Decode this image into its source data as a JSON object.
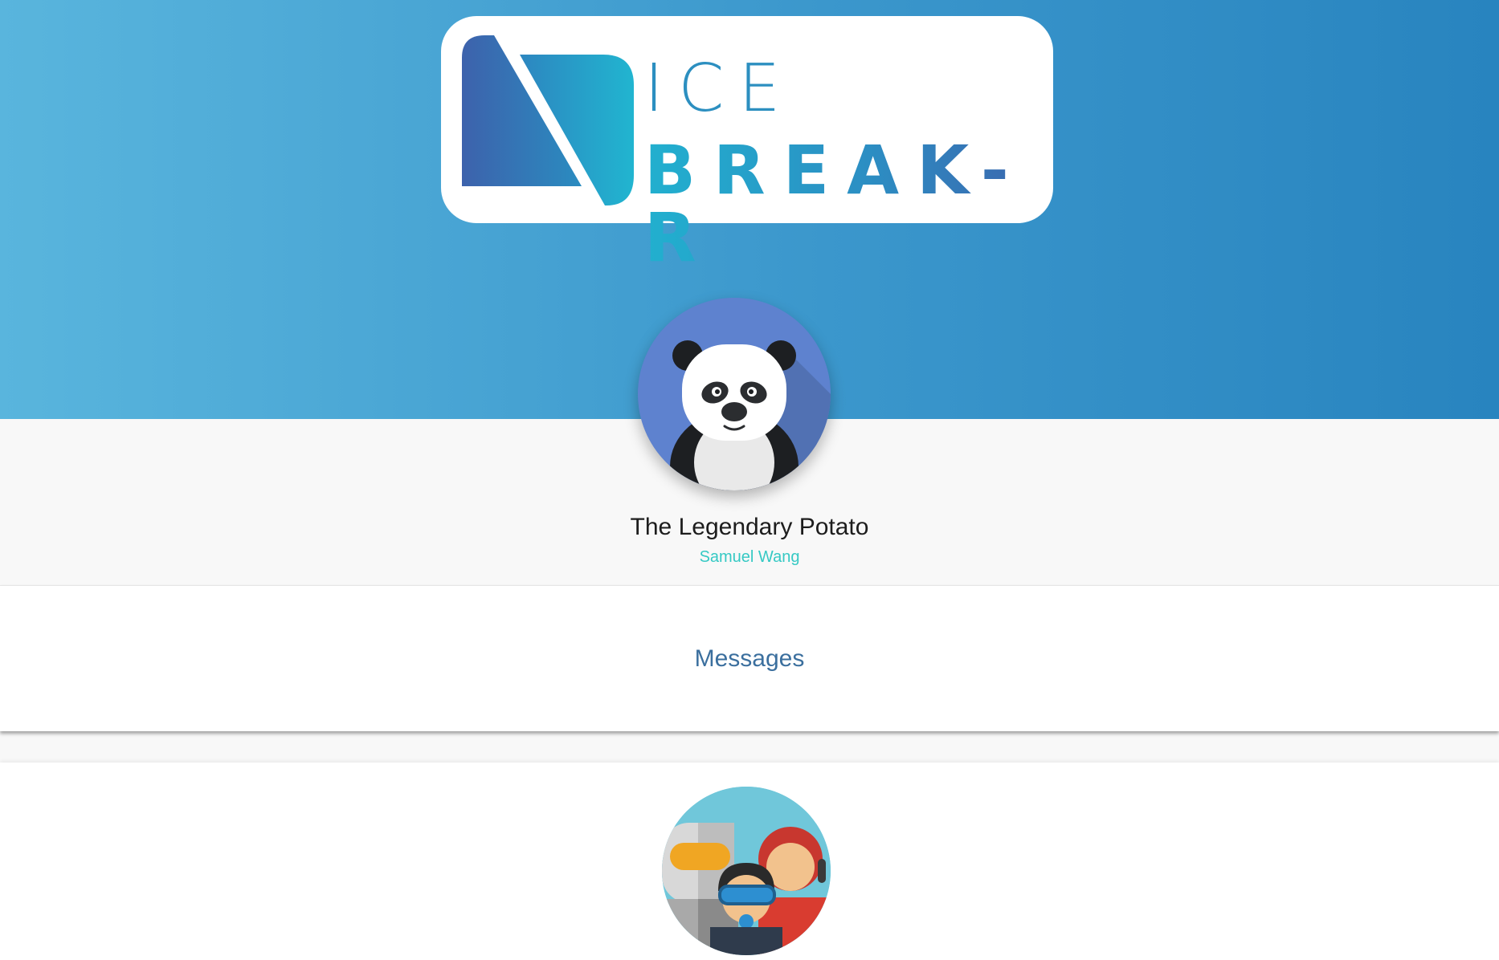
{
  "logo": {
    "line1": "ICE",
    "line2": "BREAK-R",
    "colors": {
      "cyan": "#21b0cf",
      "blue": "#3d62ac",
      "header_start": "#59b5dd",
      "header_end": "#2884bf"
    }
  },
  "profile": {
    "avatar_icon": "panda-avatar",
    "display_name": "The Legendary Potato",
    "real_name": "Samuel Wang",
    "real_name_color": "#35c9c4"
  },
  "actions": {
    "messages_label": "Messages"
  },
  "group": {
    "avatar_icon": "group-people-avatar"
  }
}
